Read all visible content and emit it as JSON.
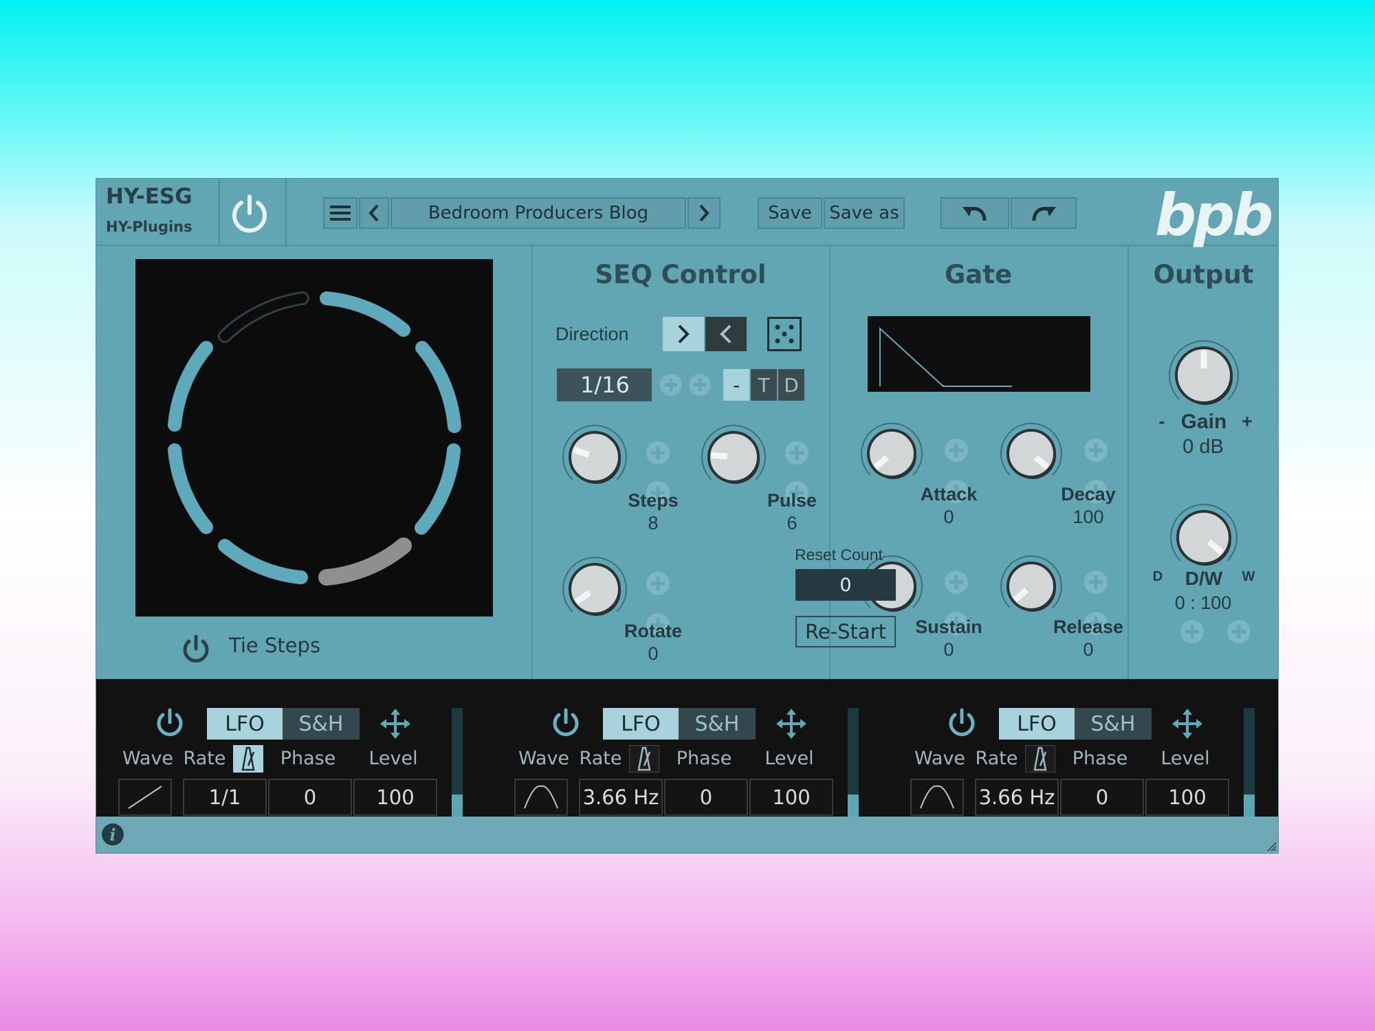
{
  "brand": {
    "title": "HY-ESG",
    "subtitle": "HY-Plugins",
    "logo": "bpb"
  },
  "header": {
    "preset_name": "Bedroom Producers Blog",
    "save_label": "Save",
    "save_as_label": "Save as",
    "icons": [
      "power-icon",
      "menu-icon",
      "chevron-left-icon",
      "chevron-right-icon",
      "undo-icon",
      "redo-icon"
    ]
  },
  "sequencer": {
    "steps_total": 8,
    "tie_steps_label": "Tie Steps",
    "ring_color": "#5fa9bc",
    "active_color": "#8f8f8f"
  },
  "seq_control": {
    "title": "SEQ Control",
    "direction_label": "Direction",
    "rate_value": "1/16",
    "mode_buttons": [
      "-",
      "T",
      "D"
    ],
    "steps_label": "Steps",
    "steps_value": "8",
    "pulse_label": "Pulse",
    "pulse_value": "6",
    "rotate_label": "Rotate",
    "rotate_value": "0",
    "reset_count_label": "Reset Count",
    "reset_count_value": "0",
    "restart_label": "Re-Start"
  },
  "gate": {
    "title": "Gate",
    "attack_label": "Attack",
    "attack_value": "0",
    "decay_label": "Decay",
    "decay_value": "100",
    "sustain_label": "Sustain",
    "sustain_value": "0",
    "release_label": "Release",
    "release_value": "0"
  },
  "output": {
    "title": "Output",
    "gain_label": "Gain",
    "gain_minus": "-",
    "gain_plus": "+",
    "gain_value": "0 dB",
    "dw_label": "D/W",
    "dw_left": "D",
    "dw_right": "W",
    "dw_value": "0 : 100"
  },
  "lfos": [
    {
      "tab_lfo": "LFO",
      "tab_sh": "S&H",
      "wave_label": "Wave",
      "rate_label": "Rate",
      "phase_label": "Phase",
      "level_label": "Level",
      "wave_shape": "ramp",
      "rate_value": "1/1",
      "phase_value": "0",
      "level_value": "100"
    },
    {
      "tab_lfo": "LFO",
      "tab_sh": "S&H",
      "wave_label": "Wave",
      "rate_label": "Rate",
      "phase_label": "Phase",
      "level_label": "Level",
      "wave_shape": "arch",
      "rate_value": "3.66 Hz",
      "phase_value": "0",
      "level_value": "100"
    },
    {
      "tab_lfo": "LFO",
      "tab_sh": "S&H",
      "wave_label": "Wave",
      "rate_label": "Rate",
      "phase_label": "Phase",
      "level_label": "Level",
      "wave_shape": "arch",
      "rate_value": "3.66 Hz",
      "phase_value": "0",
      "level_value": "100"
    }
  ],
  "footer": {
    "icon": "info-icon"
  }
}
